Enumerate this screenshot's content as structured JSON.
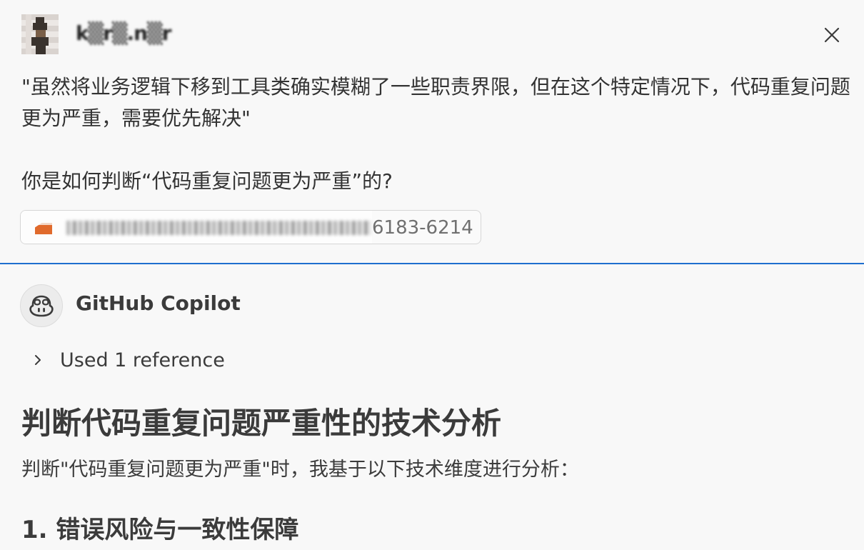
{
  "user_message": {
    "username": "k▒r▒.n▒r",
    "line1": "\"虽然将业务逻辑下移到工具类确实模糊了一些职责界限，但在这个特定情况下，代码重复问题更为严重，需要优先解决\"",
    "line2": "你是如何判断“代码重复问题更为严重”的?",
    "reference_chip": {
      "line_range": "6183-6214"
    }
  },
  "assistant_message": {
    "name": "GitHub Copilot",
    "references_toggle": "Used 1 reference",
    "heading": "判断代码重复问题严重性的技术分析",
    "intro": "判断\"代码重复问题更为严重\"时，我基于以下技术维度进行分析：",
    "section1_heading": "1. 错误风险与一致性保障"
  },
  "icons": {
    "close": "close-icon",
    "copilot": "copilot-icon",
    "chevron": "chevron-right-icon",
    "file": "file-icon"
  },
  "colors": {
    "background": "#f8f8f8",
    "divider_accent": "#1f6fcf",
    "text": "#3b3b3b",
    "file_icon": "#e06a2c"
  }
}
